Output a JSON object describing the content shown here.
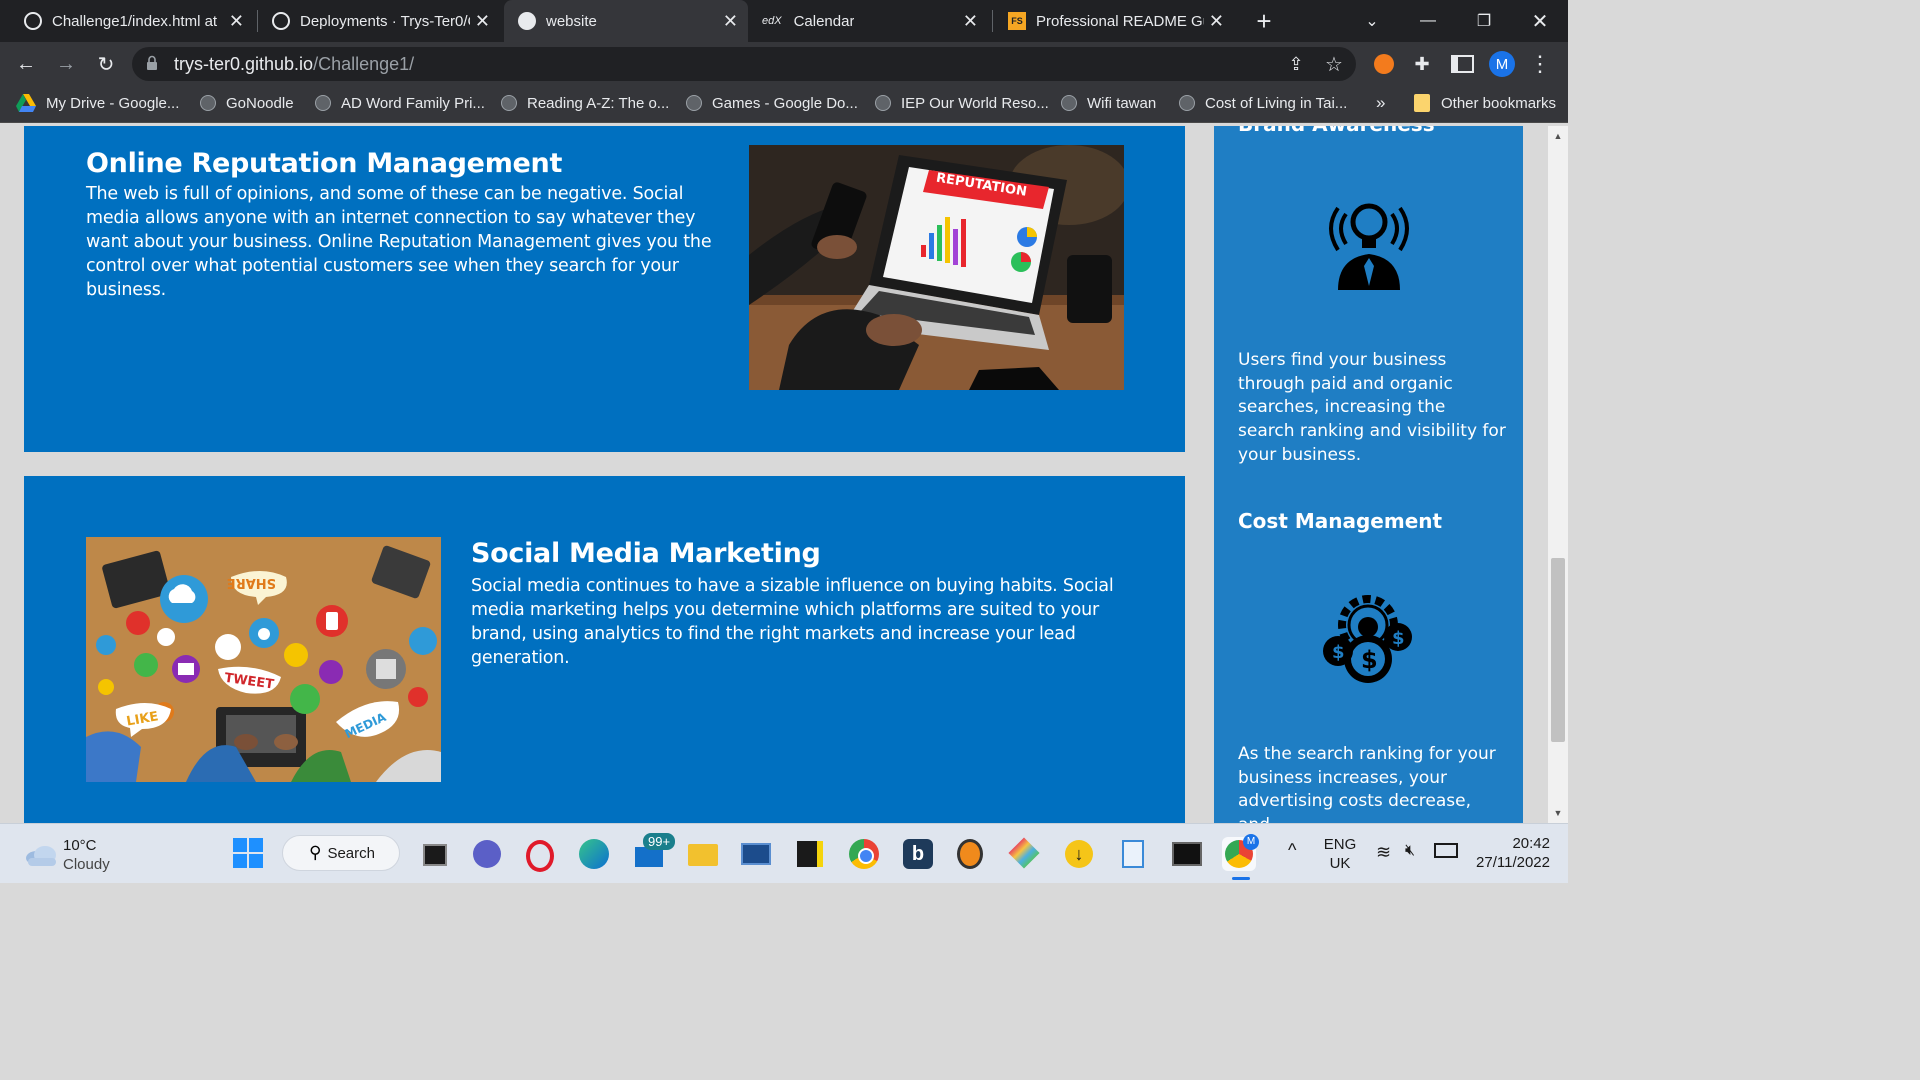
{
  "browser": {
    "tabs": [
      {
        "title": "Challenge1/index.html at",
        "favicon": "github-icon",
        "active": false
      },
      {
        "title": "Deployments · Trys-Ter0/C",
        "favicon": "github-icon",
        "active": false
      },
      {
        "title": "website",
        "favicon": "globe-icon",
        "active": true
      },
      {
        "title": "Calendar",
        "favicon": "edx-icon",
        "active": false
      },
      {
        "title": "Professional README Gui",
        "favicon": "fs-icon",
        "active": false
      }
    ],
    "favicon_edx_text": "edX",
    "favicon_fs_text": "FS",
    "new_tab": "+",
    "url_host": "trys-ter0.github.io",
    "url_path": "/Challenge1/",
    "profile_initial": "M",
    "bookmarks": [
      "My Drive - Google...",
      "GoNoodle",
      "AD Word Family Pri...",
      "Reading A-Z: The o...",
      "Games - Google Do...",
      "IEP Our World Reso...",
      "Wifi tawan",
      "Cost of Living in Tai..."
    ],
    "bookmarks_overflow": "»",
    "other_bookmarks": "Other bookmarks"
  },
  "page": {
    "reputation": {
      "title": "Online Reputation Management",
      "body": "The web is full of opinions, and some of these can be negative. Social media allows anyone with an internet connection to say whatever they want about your business. Online Reputation Management gives you the control over what potential customers see when they search for your business.",
      "image_caption": "REPUTATION"
    },
    "social": {
      "title": "Social Media Marketing",
      "body": "Social media continues to have a sizable influence on buying habits. Social media marketing helps you determine which platforms are suited to your brand, using analytics to find the right markets and increase your lead generation.",
      "image_words": [
        "SHARE",
        "TWEET",
        "LIKE",
        "MEDIA"
      ]
    },
    "sidebar": {
      "brand_title": "Brand Awareness",
      "brand_body": "Users find your business through paid and organic searches, increasing the search ranking and visibility for your business.",
      "cost_title": "Cost Management",
      "cost_body": "As the search ranking for your business increases, your advertising costs decrease, and"
    }
  },
  "taskbar": {
    "weather_temp": "10°C",
    "weather_desc": "Cloudy",
    "search_label": "Search",
    "mail_badge": "99+",
    "lang_top": "ENG",
    "lang_bottom": "UK",
    "time": "20:42",
    "date": "27/11/2022",
    "profile_initial": "M"
  },
  "colors": {
    "card_bg": "#0070c0",
    "sidebar_bg": "#1f7ec4",
    "page_bg": "#d9d9d9",
    "chrome_dark": "#202124",
    "chrome_toolbar": "#35363a"
  }
}
